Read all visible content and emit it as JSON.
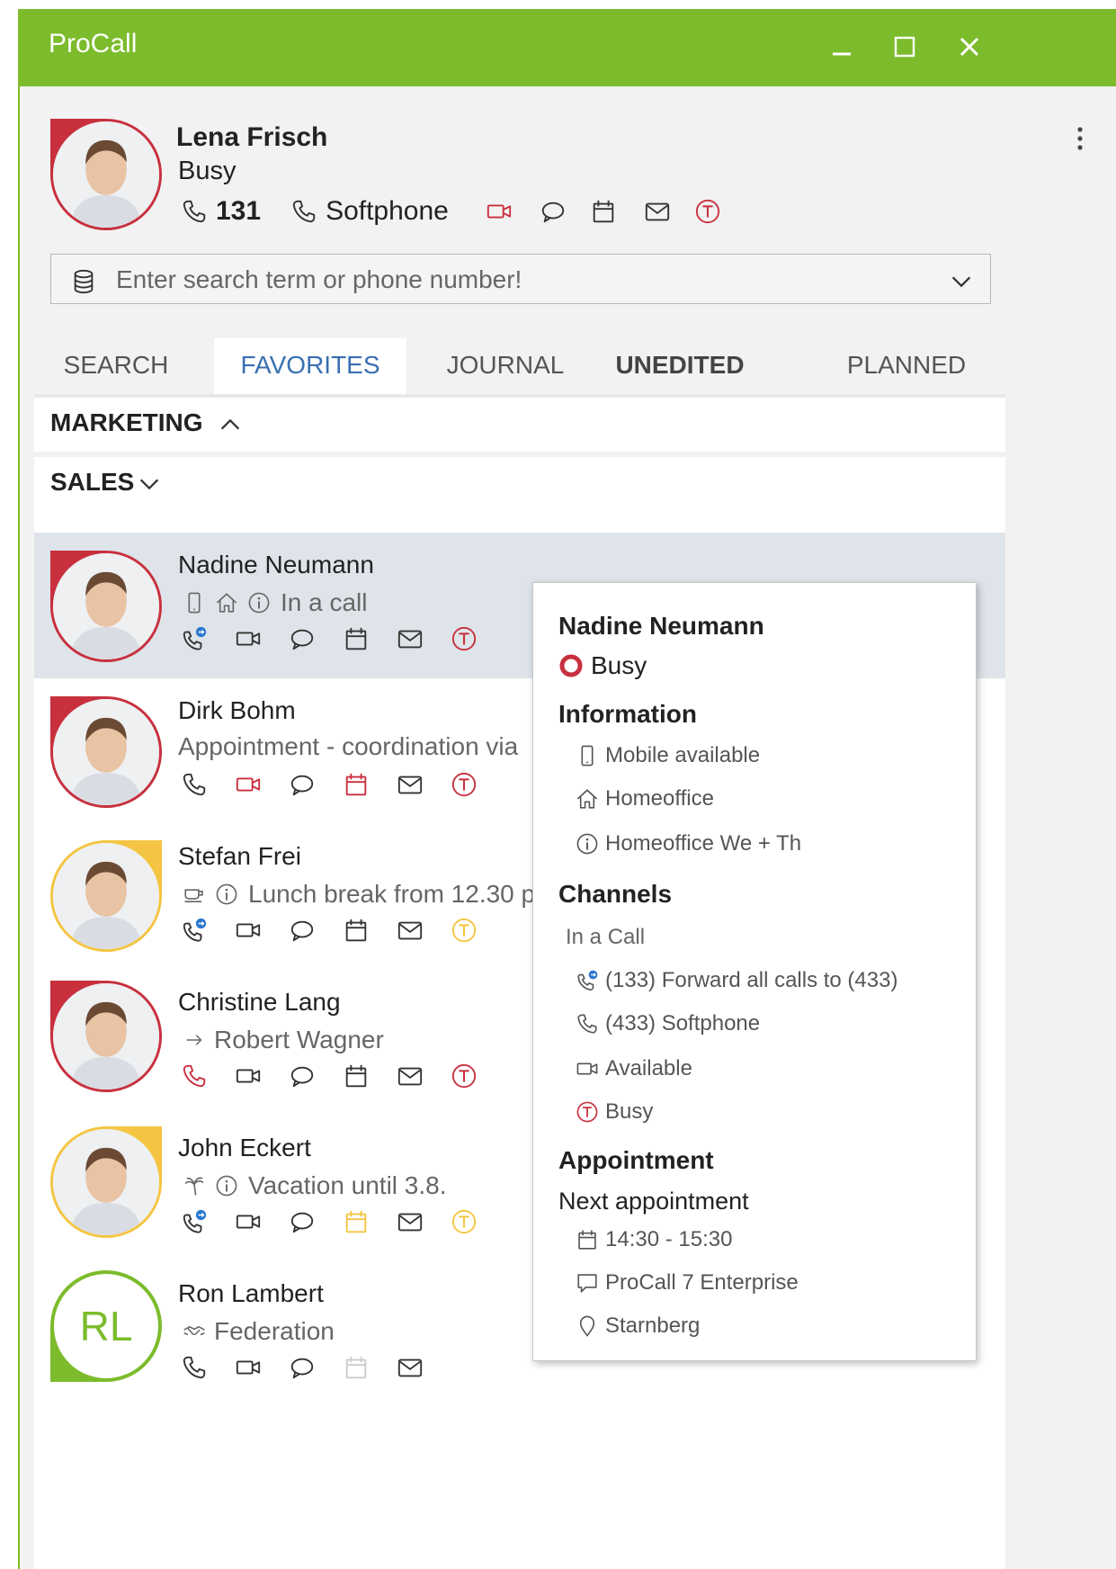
{
  "app": {
    "title": "ProCall"
  },
  "colors": {
    "accent": "#7cbc2c",
    "busy": "#c8303e",
    "away": "#f4c542",
    "link": "#3a6fb0"
  },
  "user": {
    "name": "Lena Frisch",
    "status": "Busy",
    "extension": "131",
    "device": "Softphone"
  },
  "search": {
    "placeholder": "Enter search term or phone number!"
  },
  "tabs": [
    "SEARCH",
    "FAVORITES",
    "JOURNAL",
    "UNEDITED",
    "PLANNED"
  ],
  "groups": {
    "marketing": "MARKETING",
    "sales": "SALES"
  },
  "contacts": [
    {
      "name": "Nadine Neumann",
      "info": "In a call",
      "presence": "busy",
      "icons": [
        "mobile-icon",
        "home-icon",
        "info-icon"
      ]
    },
    {
      "name": "Dirk Bohm",
      "info": "Appointment - coordination via",
      "presence": "busy"
    },
    {
      "name": "Stefan Frei",
      "info": "Lunch break from 12.30 p",
      "presence": "away"
    },
    {
      "name": "Christine Lang",
      "info": "Robert Wagner",
      "presence": "busy"
    },
    {
      "name": "John Eckert",
      "info": "Vacation until 3.8.",
      "presence": "away"
    },
    {
      "name": "Ron Lambert",
      "initials": "RL",
      "info": "Federation",
      "presence": "available"
    }
  ],
  "popup": {
    "name": "Nadine Neumann",
    "status": "Busy",
    "information_title": "Information",
    "information": [
      "Mobile available",
      "Homeoffice",
      "Homeoffice We + Th"
    ],
    "channels_title": "Channels",
    "channels_sub": "In a Call",
    "channels": [
      "(133) Forward all calls to (433)",
      "(433) Softphone",
      "Available",
      "Busy"
    ],
    "appointment_title": "Appointment",
    "appointment_sub": "Next appointment",
    "appointment": [
      "14:30 - 15:30",
      "ProCall 7 Enterprise",
      "Starnberg"
    ]
  }
}
